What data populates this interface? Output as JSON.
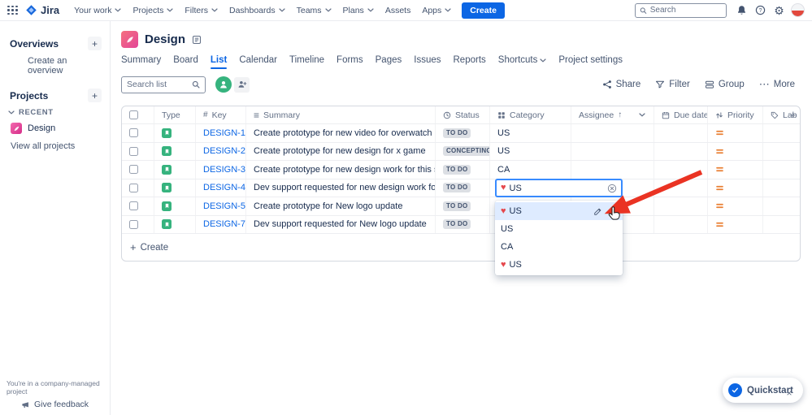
{
  "navbar": {
    "logo_text": "Jira",
    "items": [
      {
        "label": "Your work"
      },
      {
        "label": "Projects"
      },
      {
        "label": "Filters"
      },
      {
        "label": "Dashboards"
      },
      {
        "label": "Teams"
      },
      {
        "label": "Plans"
      },
      {
        "label": "Assets"
      },
      {
        "label": "Apps"
      }
    ],
    "create_label": "Create",
    "search_placeholder": "Search"
  },
  "sidebar": {
    "overviews_title": "Overviews",
    "create_overview_label": "Create an overview",
    "projects_title": "Projects",
    "recent_label": "RECENT",
    "project_name": "Design",
    "view_all_label": "View all projects",
    "footer_note": "You're in a company-managed project",
    "feedback_label": "Give feedback"
  },
  "project": {
    "title": "Design"
  },
  "tabs": {
    "active": "List",
    "items": [
      "Summary",
      "Board",
      "List",
      "Calendar",
      "Timeline",
      "Forms",
      "Pages",
      "Issues",
      "Reports",
      "Shortcuts",
      "Project settings"
    ]
  },
  "toolbar": {
    "search_placeholder": "Search list",
    "share_label": "Share",
    "filter_label": "Filter",
    "group_label": "Group",
    "more_label": "More"
  },
  "table": {
    "headers": {
      "type": "Type",
      "key": "Key",
      "summary": "Summary",
      "status": "Status",
      "category": "Category",
      "assignee": "Assignee",
      "due_date": "Due date",
      "priority": "Priority",
      "labels": "Labels"
    },
    "rows": [
      {
        "type": "Story",
        "key": "DESIGN-1",
        "summary": "Create prototype for new video for overwatch",
        "status": "TO DO",
        "category": "US",
        "priority": "Medium"
      },
      {
        "type": "Story",
        "key": "DESIGN-2",
        "summary": "Create prototype for new design for x game",
        "status": "CONCEPTING",
        "category": "US",
        "priority": "Medium"
      },
      {
        "type": "Story",
        "key": "DESIGN-3",
        "summary": "Create prototype for new design work for this system",
        "status": "TO DO",
        "category": "CA",
        "priority": "Medium"
      },
      {
        "type": "Story",
        "key": "DESIGN-4",
        "summary": "Dev support requested for new design work for this system",
        "status": "TO DO",
        "category": "",
        "priority": "Medium"
      },
      {
        "type": "Story",
        "key": "DESIGN-5",
        "summary": "Create prototype for New logo update",
        "status": "TO DO",
        "category": "",
        "priority": "Medium"
      },
      {
        "type": "Story",
        "key": "DESIGN-7",
        "summary": "Dev support requested for New logo update",
        "status": "TO DO",
        "category": "",
        "priority": "Medium"
      }
    ],
    "create_label": "Create"
  },
  "category_editor": {
    "value_icon": "♥",
    "value_text": "US",
    "options": [
      {
        "icon": "♥",
        "label": "US",
        "selected": true
      },
      {
        "icon": "",
        "label": "US",
        "selected": false
      },
      {
        "icon": "",
        "label": "CA",
        "selected": false
      },
      {
        "icon": "♥",
        "label": "US",
        "selected": false
      }
    ]
  },
  "quickstart": {
    "label": "Quickstart"
  },
  "icons": {
    "summary_icon": "≡",
    "key_icon": "#",
    "sort_ascending_icon": "↑",
    "more_icon": "⋯",
    "add_icon": "+",
    "gear_icon": "⚙",
    "dismiss_icon": "×"
  },
  "colors": {
    "accent_blue": "#0C66E4",
    "selected_option_bg": "#DEEBFF",
    "status_lozenge_bg": "#DCDFE4",
    "story_green": "#36B37E",
    "priority_medium_orange": "#E97F33",
    "heart_red": "#E5484D",
    "annotation_arrow_red": "#EA3323",
    "focus_border_blue": "#388BFF"
  }
}
